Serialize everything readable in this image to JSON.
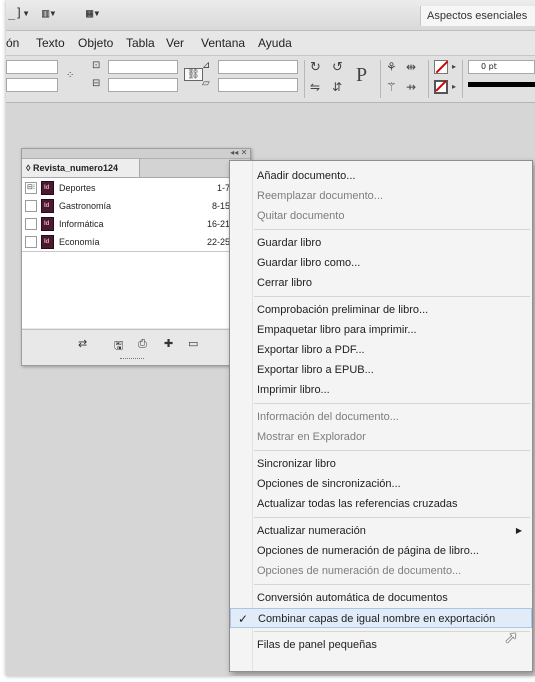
{
  "app": {
    "workspace_label": "Aspectos esenciales",
    "top_icons": [
      "_]▾",
      "▥▾",
      "▦▾"
    ]
  },
  "menubar": {
    "items": [
      "ón",
      "Texto",
      "Objeto",
      "Tabla",
      "Ver",
      "Ventana",
      "Ayuda"
    ]
  },
  "controlbar": {
    "stroke_weight": "0 pt"
  },
  "book_panel": {
    "title": "◊ Revista_numero124",
    "collapse_label": "◂◂ ✕",
    "menu_icon": "panel-menu-icon",
    "documents": [
      {
        "name": "Deportes",
        "pages": "1-7"
      },
      {
        "name": "Gastronomía",
        "pages": "8-15"
      },
      {
        "name": "Informática",
        "pages": "16-21"
      },
      {
        "name": "Economía",
        "pages": "22-25"
      }
    ]
  },
  "context_menu": {
    "groups": [
      {
        "items": [
          {
            "label": "Añadir documento...",
            "enabled": true
          },
          {
            "label": "Reemplazar documento...",
            "enabled": false
          },
          {
            "label": "Quitar documento",
            "enabled": false
          }
        ]
      },
      {
        "items": [
          {
            "label": "Guardar libro",
            "enabled": true
          },
          {
            "label": "Guardar libro como...",
            "enabled": true
          },
          {
            "label": "Cerrar libro",
            "enabled": true
          }
        ]
      },
      {
        "items": [
          {
            "label": "Comprobación preliminar de libro...",
            "enabled": true
          },
          {
            "label": "Empaquetar libro para imprimir...",
            "enabled": true
          },
          {
            "label": "Exportar libro a PDF...",
            "enabled": true
          },
          {
            "label": "Exportar libro a EPUB...",
            "enabled": true
          },
          {
            "label": "Imprimir libro...",
            "enabled": true
          }
        ]
      },
      {
        "items": [
          {
            "label": "Información del documento...",
            "enabled": false
          },
          {
            "label": "Mostrar en Explorador",
            "enabled": false
          }
        ]
      },
      {
        "items": [
          {
            "label": "Sincronizar libro",
            "enabled": true
          },
          {
            "label": "Opciones de sincronización...",
            "enabled": true
          },
          {
            "label": "Actualizar todas las referencias cruzadas",
            "enabled": true
          }
        ]
      },
      {
        "items": [
          {
            "label": "Actualizar numeración",
            "enabled": true,
            "submenu": true
          },
          {
            "label": "Opciones de numeración de página de libro...",
            "enabled": true
          },
          {
            "label": "Opciones de numeración de documento...",
            "enabled": false
          }
        ]
      },
      {
        "items": [
          {
            "label": "Conversión automática de documentos",
            "enabled": true
          },
          {
            "label": "Combinar capas de igual nombre en exportación",
            "enabled": true,
            "checked": true,
            "highlighted": true
          }
        ]
      },
      {
        "items": [
          {
            "label": "Filas de panel pequeñas",
            "enabled": true
          }
        ]
      }
    ]
  }
}
